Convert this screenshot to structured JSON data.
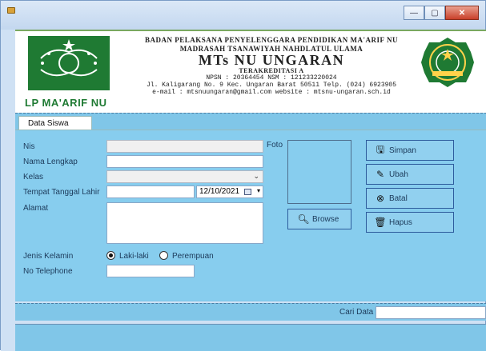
{
  "window": {
    "minimize": "—",
    "maximize": "▢",
    "close": "✕"
  },
  "header": {
    "lp_label": "LP MA'ARIF NU",
    "line1": "BADAN PELAKSANA PENYELENGGARA PENDIDIKAN MA'ARIF NU",
    "line2": "MADRASAH TSANAWIYAH NAHDLATUL ULAMA",
    "school_name": "MTs NU UNGARAN",
    "accreditation": "TERAKREDITASI A",
    "npsn": "NPSN : 20364454          NSM : 121233220024",
    "address": "Jl. Kaligarang No. 9 Kec. Ungaran Barat 50511  Telp. (024) 6923905",
    "contact": "e-mail : mtsnuungaran@gmail.com website : mtsnu-ungaran.sch.id"
  },
  "tab": {
    "label": "Data Siswa"
  },
  "form": {
    "nis_label": "Nis",
    "nama_label": "Nama Lengkap",
    "kelas_label": "Kelas",
    "ttl_label": "Tempat Tanggal Lahir",
    "date_value": "12/10/2021",
    "alamat_label": "Alamat",
    "foto_label": "Foto",
    "jk_label": "Jenis Kelamin",
    "jk_male": "Laki-laki",
    "jk_female": "Perempuan",
    "telp_label": "No Telephone"
  },
  "buttons": {
    "browse": "Browse",
    "simpan": "Simpan",
    "ubah": "Ubah",
    "batal": "Batal",
    "hapus": "Hapus"
  },
  "search": {
    "label": "Cari Data"
  },
  "colors": {
    "panel": "#87cdee",
    "accent_green": "#1f7a33"
  }
}
